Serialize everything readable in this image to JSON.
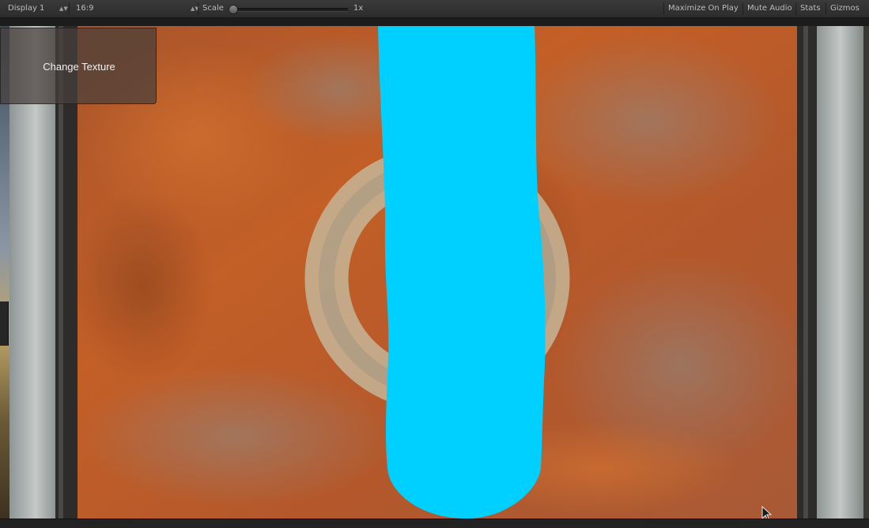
{
  "toolbar": {
    "display": "Display 1",
    "aspect": "16:9",
    "scale_label": "Scale",
    "scale_value": 0.0,
    "scale_readout": "1x",
    "maximize": "Maximize On Play",
    "mute": "Mute Audio",
    "stats": "Stats",
    "gizmos": "Gizmos"
  },
  "game": {
    "change_texture_label": "Change Texture"
  },
  "colors": {
    "rust": "#b85a28",
    "paint_stroke": "#00d0ff",
    "metal_frame": "#a9aeac",
    "ring": "#c5b89a"
  },
  "icons": {
    "dropdown": "up-down-arrow-icon",
    "cursor": "mouse-pointer-icon"
  }
}
